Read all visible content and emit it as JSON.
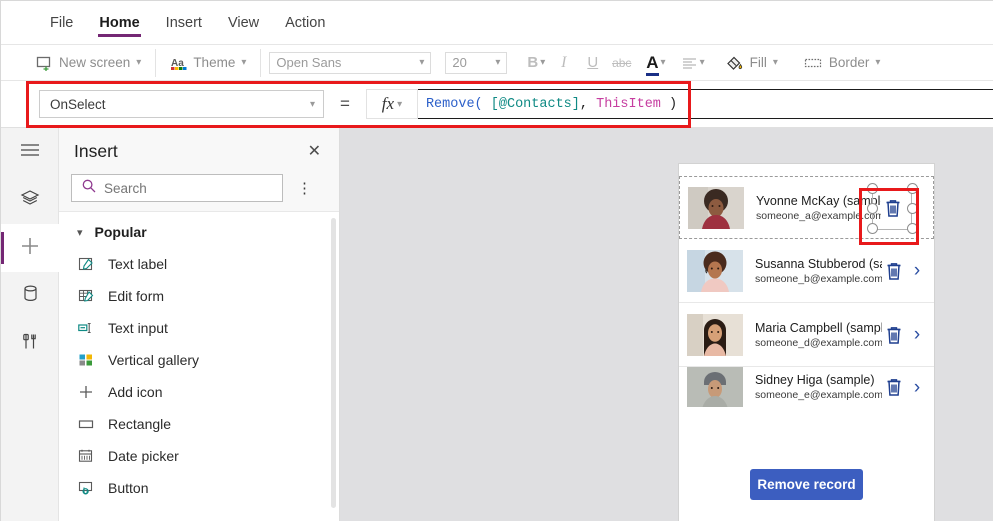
{
  "menu": {
    "tabs": [
      {
        "label": "File",
        "active": false
      },
      {
        "label": "Home",
        "active": true
      },
      {
        "label": "Insert",
        "active": false
      },
      {
        "label": "View",
        "active": false
      },
      {
        "label": "Action",
        "active": false
      }
    ]
  },
  "toolbar": {
    "new_screen_label": "New screen",
    "theme_label": "Theme",
    "font_value": "Open Sans",
    "font_size_value": "20",
    "bold_label": "B",
    "italic_label": "I",
    "underline_label": "U",
    "strikethrough_label": "abc",
    "font_color_label": "A",
    "align_label": "align",
    "fill_label": "Fill",
    "border_label": "Border"
  },
  "formula_bar": {
    "property_value": "OnSelect",
    "equals": "=",
    "fx_label": "fx",
    "formula_text": "Remove( [@Contacts], ThisItem )",
    "tokens": [
      {
        "text": "Remove(",
        "kind": "fn"
      },
      {
        "text": " ",
        "kind": "punc"
      },
      {
        "text": "[@Contacts]",
        "kind": "src"
      },
      {
        "text": ", ",
        "kind": "punc"
      },
      {
        "text": "ThisItem",
        "kind": "this"
      },
      {
        "text": " )",
        "kind": "punc"
      }
    ]
  },
  "rail": {
    "items": [
      {
        "name": "hamburger-menu-icon",
        "active": false
      },
      {
        "name": "tree-view-icon",
        "active": false
      },
      {
        "name": "insert-icon",
        "active": true
      },
      {
        "name": "data-icon",
        "active": false
      },
      {
        "name": "tools-icon",
        "active": false
      }
    ]
  },
  "panel": {
    "title": "Insert",
    "close_label": "✕",
    "search_placeholder": "Search",
    "search_value": "",
    "kebab_label": "⋮",
    "group_label": "Popular",
    "items": [
      {
        "label": "Text label",
        "icon": "text-label-icon"
      },
      {
        "label": "Edit form",
        "icon": "edit-form-icon"
      },
      {
        "label": "Text input",
        "icon": "text-input-icon"
      },
      {
        "label": "Vertical gallery",
        "icon": "vertical-gallery-icon"
      },
      {
        "label": "Add icon",
        "icon": "add-icon"
      },
      {
        "label": "Rectangle",
        "icon": "rectangle-icon"
      },
      {
        "label": "Date picker",
        "icon": "date-picker-icon"
      },
      {
        "label": "Button",
        "icon": "button-icon"
      }
    ]
  },
  "canvas": {
    "gallery_rows": [
      {
        "name": "Yvonne McKay (sample)",
        "email": "someone_a@example.com",
        "selected": true,
        "clipped": false
      },
      {
        "name": "Susanna Stubberod (sample)",
        "email": "someone_b@example.com",
        "selected": false,
        "clipped": false
      },
      {
        "name": "Maria Campbell (sample)",
        "email": "someone_d@example.com",
        "selected": false,
        "clipped": false
      },
      {
        "name": "Sidney Higa (sample)",
        "email": "someone_e@example.com",
        "selected": false,
        "clipped": true
      }
    ],
    "remove_button_label": "Remove record"
  },
  "colors": {
    "accent_purple": "#742774",
    "annotation_red": "#e8191b",
    "button_blue": "#3c5ec0",
    "icon_blue": "#2b4ea2",
    "formula_fn": "#2b5fc9",
    "formula_source": "#0f8a84",
    "formula_thisitem": "#c63ea0"
  }
}
